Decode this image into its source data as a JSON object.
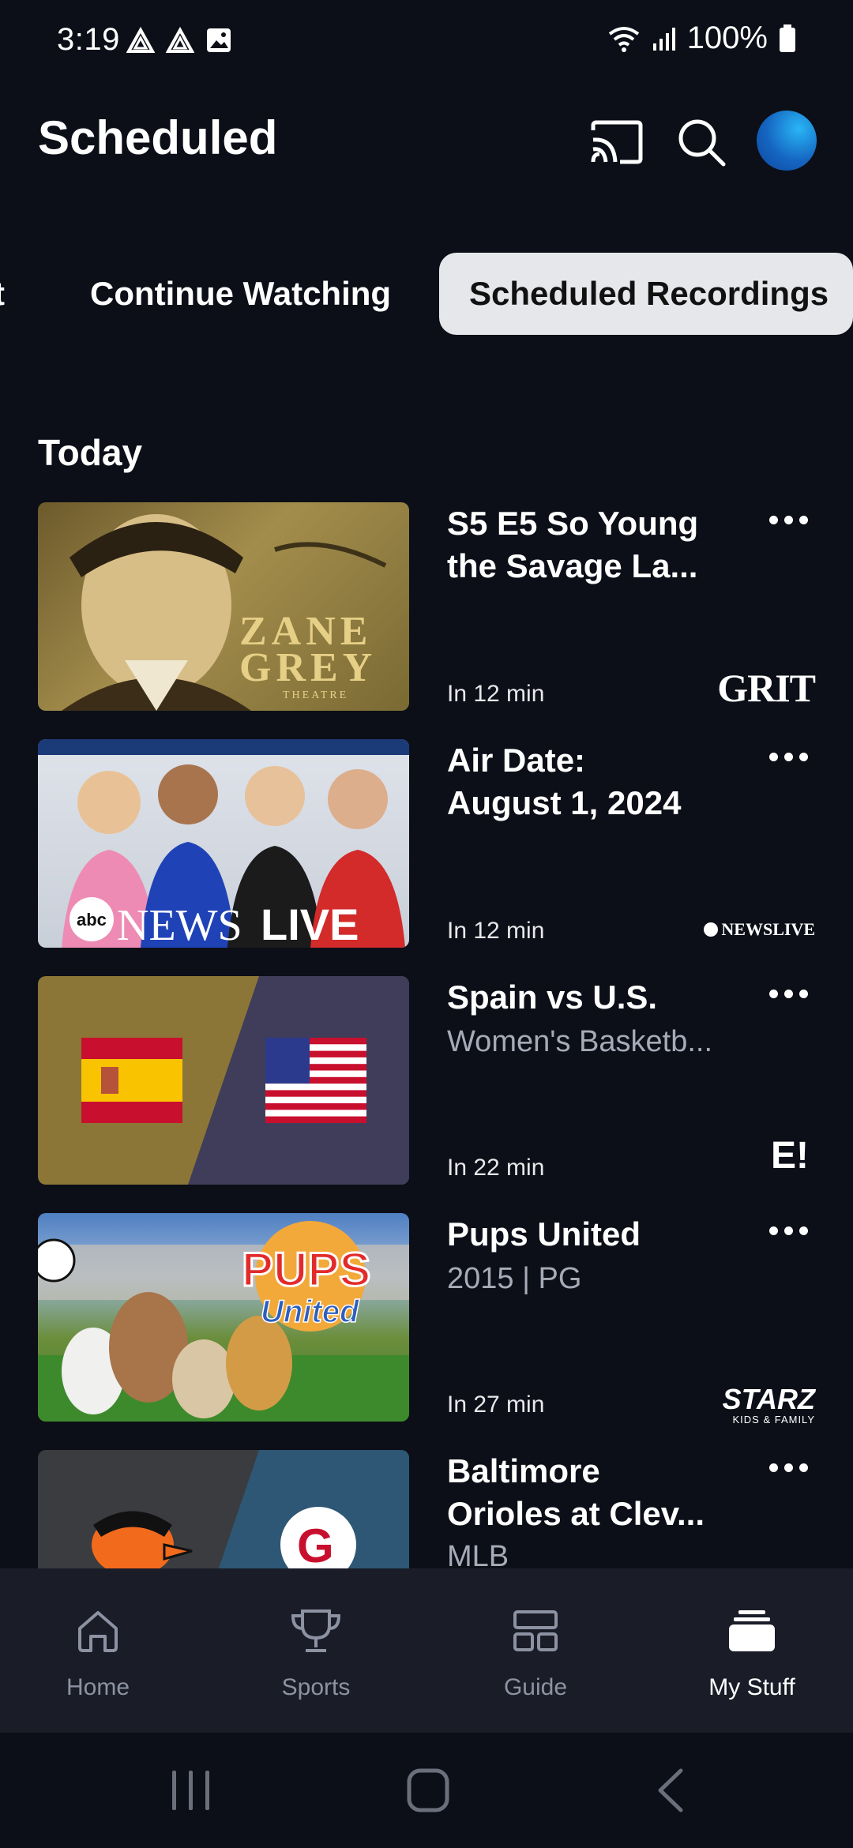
{
  "status_bar": {
    "time": "3:19",
    "battery": "100%"
  },
  "header": {
    "title": "Scheduled"
  },
  "tabs": [
    {
      "label": "t"
    },
    {
      "label": "Continue Watching"
    },
    {
      "label": "Scheduled Recordings"
    }
  ],
  "section_title": "Today",
  "items": [
    {
      "title": "S5 E5 So Young\nthe Savage La...",
      "subtitle": "",
      "time": "In 12 min",
      "network": "GRIT",
      "thumb_text": [
        "ZANE",
        "GREY",
        "THEATRE"
      ]
    },
    {
      "title": "Air Date:\nAugust 1, 2024",
      "subtitle": "",
      "time": "In 12 min",
      "network": "NEWSLIVE",
      "thumb_text": [
        "abc",
        "NEWS",
        "LIVE",
        "NEWSLIVE"
      ]
    },
    {
      "title": "Spain vs U.S.",
      "subtitle": "Women's Basketb...",
      "time": "In 22 min",
      "network": "E!",
      "thumb_text": []
    },
    {
      "title": "Pups United",
      "subtitle": "2015 | PG",
      "time": "In 27 min",
      "network": "STARZ",
      "network_sub": "KIDS & FAMILY",
      "thumb_text": [
        "PUPS",
        "United"
      ]
    },
    {
      "title": "Baltimore\nOrioles at Clev...",
      "subtitle": "MLB",
      "time": "",
      "network": "",
      "thumb_text": []
    }
  ],
  "bottom_nav": [
    {
      "label": "Home",
      "icon": "home-icon"
    },
    {
      "label": "Sports",
      "icon": "trophy-icon"
    },
    {
      "label": "Guide",
      "icon": "guide-icon"
    },
    {
      "label": "My Stuff",
      "icon": "my-stuff-icon",
      "selected": true
    }
  ],
  "colors": {
    "background": "#0c0f17",
    "nav_bg": "#1a1d28",
    "active_tab": "#e6e7ea",
    "muted": "#a7abb8"
  }
}
